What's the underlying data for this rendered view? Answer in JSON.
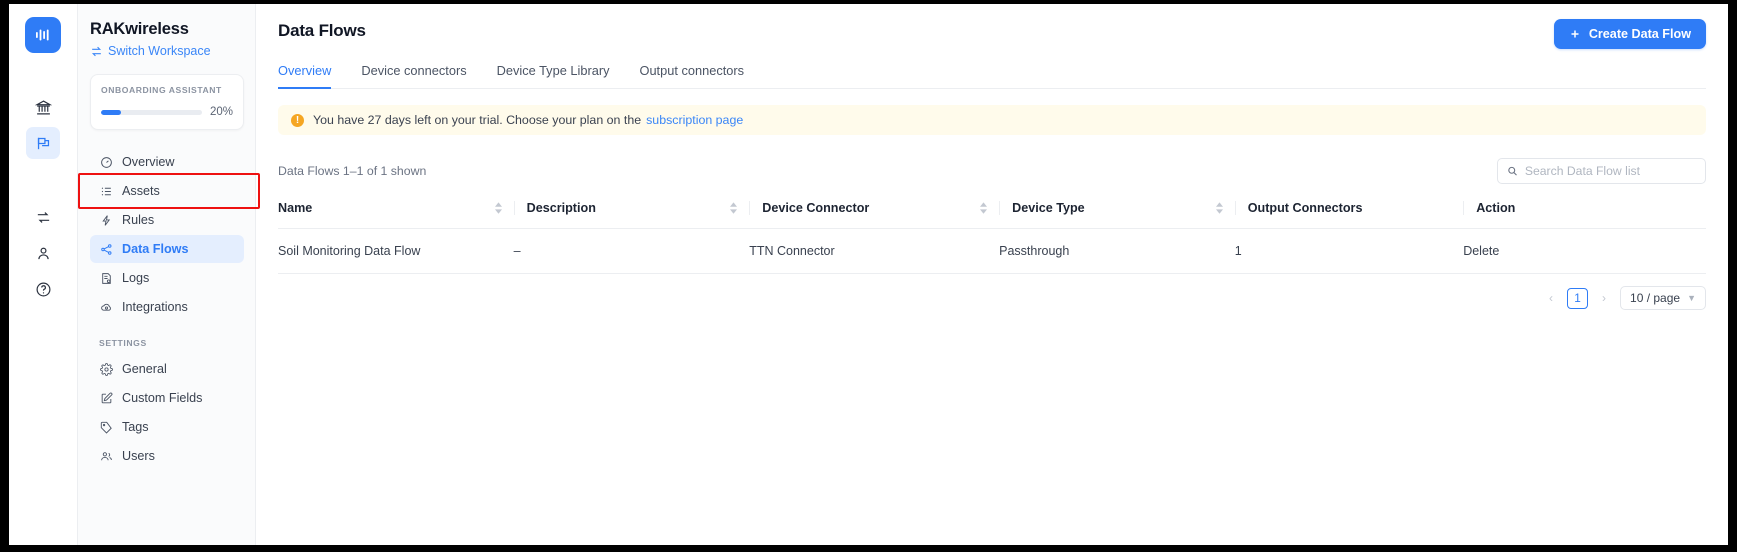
{
  "rail": {
    "logo_icon": "audio-waveform-logo",
    "items": [
      {
        "name": "organization",
        "icon": "bank-icon",
        "active": false
      },
      {
        "name": "workspace",
        "icon": "flag-icon",
        "active": true
      },
      {
        "name": "transfer",
        "icon": "transfer-icon",
        "active": false
      },
      {
        "name": "account",
        "icon": "user-icon",
        "active": false
      },
      {
        "name": "help",
        "icon": "help-circle-icon",
        "active": false
      }
    ]
  },
  "sidebar": {
    "workspace_name": "RAKwireless",
    "switch_workspace": "Switch Workspace",
    "switch_icon": "switch-arrows-icon",
    "onboarding": {
      "label": "ONBOARDING ASSISTANT",
      "percent_label": "20%",
      "percent_value": 20
    },
    "items": [
      {
        "label": "Overview",
        "icon": "dashboard-icon",
        "active": false,
        "highlight": false
      },
      {
        "label": "Assets",
        "icon": "list-icon",
        "active": false,
        "highlight": true
      },
      {
        "label": "Rules",
        "icon": "bolt-icon",
        "active": false,
        "highlight": false
      },
      {
        "label": "Data Flows",
        "icon": "share-nodes-icon",
        "active": true,
        "highlight": false
      },
      {
        "label": "Logs",
        "icon": "log-document-icon",
        "active": false,
        "highlight": false
      },
      {
        "label": "Integrations",
        "icon": "cloud-link-icon",
        "active": false,
        "highlight": false
      }
    ],
    "settings_label": "SETTINGS",
    "settings_items": [
      {
        "label": "General",
        "icon": "gear-icon"
      },
      {
        "label": "Custom Fields",
        "icon": "edit-square-icon"
      },
      {
        "label": "Tags",
        "icon": "tag-icon"
      },
      {
        "label": "Users",
        "icon": "users-icon"
      }
    ]
  },
  "main": {
    "page_title": "Data Flows",
    "create_button": {
      "label": "Create Data Flow",
      "icon": "plus-icon",
      "color": "#2f7cf6"
    },
    "tabs": [
      {
        "label": "Overview",
        "active": true
      },
      {
        "label": "Device connectors",
        "active": false
      },
      {
        "label": "Device Type Library",
        "active": false
      },
      {
        "label": "Output connectors",
        "active": false
      }
    ],
    "banner": {
      "icon": "warning-circle-icon",
      "text": "You have 27 days left on your trial. Choose your plan on the ",
      "link_text": "subscription page",
      "bg_color": "#fffbeb",
      "icon_color": "#f5a623",
      "link_color": "#3a86f7"
    },
    "count_text": "Data Flows 1–1 of 1 shown",
    "search": {
      "placeholder": "Search Data Flow list",
      "value": "",
      "icon": "search-icon"
    },
    "table": {
      "columns": [
        {
          "label": "Name",
          "sortable": true
        },
        {
          "label": "Description",
          "sortable": true
        },
        {
          "label": "Device Connector",
          "sortable": true
        },
        {
          "label": "Device Type",
          "sortable": true
        },
        {
          "label": "Output Connectors",
          "sortable": false
        },
        {
          "label": "Action",
          "sortable": false
        }
      ],
      "rows": [
        {
          "name": "Soil Monitoring Data Flow",
          "description": "–",
          "device_connector": "TTN Connector",
          "device_type": "Passthrough",
          "output_connectors": "1",
          "action": "Delete"
        }
      ]
    },
    "pagination": {
      "prev_icon": "chevron-left-icon",
      "next_icon": "chevron-right-icon",
      "current_page": "1",
      "page_size": "10 / page",
      "dropdown_icon": "chevron-down-icon"
    }
  }
}
